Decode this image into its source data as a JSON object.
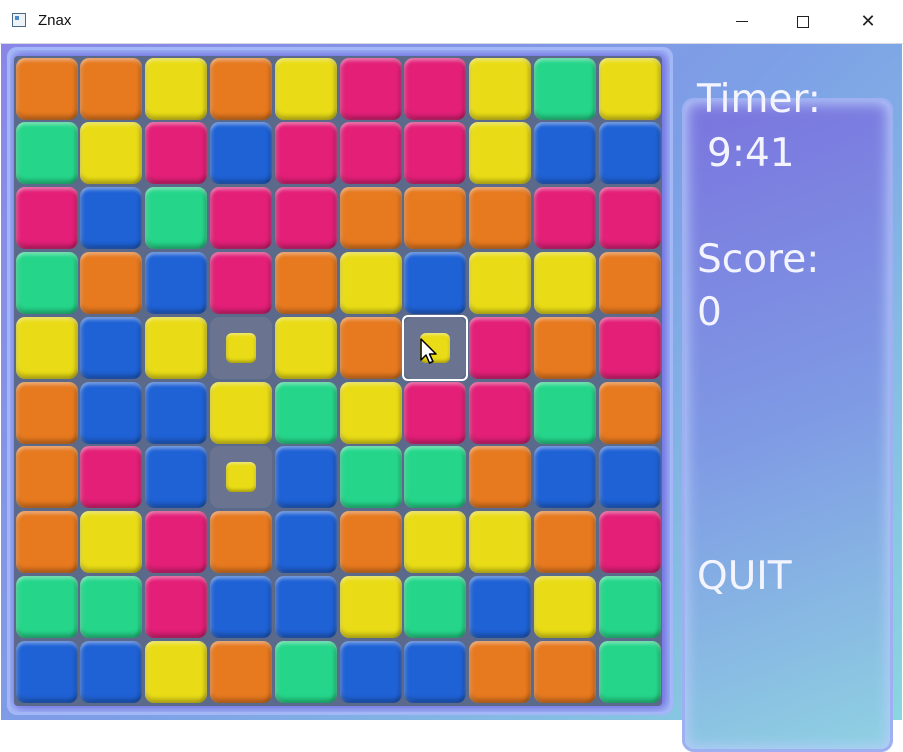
{
  "window": {
    "title": "Znax"
  },
  "colors": {
    "O": "#e7791f",
    "Y": "#e9dc16",
    "P": "#e31f78",
    "G": "#25d68a",
    "B": "#1f62d6"
  },
  "board": {
    "rows": [
      [
        "O",
        "O",
        "Y",
        "O",
        "Y",
        "P",
        "P",
        "Y",
        "G",
        "Y"
      ],
      [
        "G",
        "Y",
        "P",
        "B",
        "P",
        "P",
        "P",
        "Y",
        "B",
        "B"
      ],
      [
        "P",
        "B",
        "G",
        "P",
        "P",
        "O",
        "O",
        "O",
        "P",
        "P"
      ],
      [
        "G",
        "O",
        "B",
        "P",
        "O",
        "Y",
        "B",
        "Y",
        "Y",
        "O"
      ],
      [
        "Y",
        "B",
        "Y",
        "Y",
        "Y",
        "O",
        "Y",
        "P",
        "O",
        "P"
      ],
      [
        "O",
        "B",
        "B",
        "Y",
        "G",
        "Y",
        "P",
        "P",
        "G",
        "O"
      ],
      [
        "O",
        "P",
        "B",
        "Y",
        "B",
        "G",
        "G",
        "O",
        "B",
        "B"
      ],
      [
        "O",
        "Y",
        "P",
        "O",
        "B",
        "O",
        "Y",
        "Y",
        "O",
        "P"
      ],
      [
        "G",
        "G",
        "P",
        "B",
        "B",
        "Y",
        "G",
        "B",
        "Y",
        "G"
      ],
      [
        "B",
        "B",
        "Y",
        "O",
        "G",
        "B",
        "B",
        "O",
        "O",
        "G"
      ]
    ],
    "selected": [
      {
        "row": 4,
        "col": 3,
        "cursor": false
      },
      {
        "row": 4,
        "col": 6,
        "cursor": true
      },
      {
        "row": 6,
        "col": 3,
        "cursor": false
      }
    ]
  },
  "panel": {
    "timer_label": "Timer:",
    "timer_value": "9:41",
    "score_label": "Score:",
    "score_value": "0",
    "quit_label": "QUIT"
  }
}
